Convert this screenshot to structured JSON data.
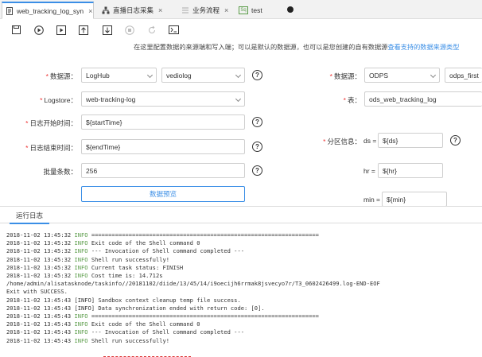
{
  "tabs": [
    {
      "label": "web_tracking_log_syn",
      "active": true,
      "close": "×",
      "icon": "document-icon"
    },
    {
      "label": "直播日志采集",
      "active": false,
      "close": "×",
      "icon": "flow-icon"
    },
    {
      "label": "业务流程",
      "active": false,
      "close": "×",
      "icon": "workflow-icon"
    },
    {
      "label": "test",
      "active": false,
      "close": "",
      "icon": "sql-icon",
      "icon_text": "Sq"
    }
  ],
  "toolbar": {
    "buttons": [
      "save-icon",
      "run-icon",
      "run-with-params-icon",
      "submit-icon",
      "download-icon",
      "stop-icon",
      "reload-icon",
      "format-icon"
    ]
  },
  "hint": {
    "text": "在这里配置数据的来源端和写入端；可以是默认的数据源，也可以是您创建的自有数据源",
    "link": "查看支持的数据来源类型"
  },
  "source": {
    "datasource_label": "数据源：",
    "datasource_type": "LogHub",
    "datasource_name": "vediolog",
    "logstore_label": "Logstore：",
    "logstore_value": "web-tracking-log",
    "start_label": "日志开始时间：",
    "start_value": "${startTime}",
    "end_label": "日志结束时间：",
    "end_value": "${endTime}",
    "batch_label": "批量条数：",
    "batch_value": "256",
    "preview_button": "数据预览",
    "help": "?"
  },
  "target": {
    "datasource_label": "数据源：",
    "datasource_type": "ODPS",
    "datasource_name": "odps_first",
    "table_label": "表：",
    "table_value": "ods_web_tracking_log",
    "partition_label": "分区信息：",
    "ds_label": "ds =",
    "ds_value": "${ds}",
    "hr_label": "hr =",
    "hr_value": "${hr}",
    "min_label": "min =",
    "min_value": "${min}",
    "help": "?"
  },
  "log": {
    "tab_label": "运行日志",
    "lines": [
      {
        "ts": "2018-11-02 13:45:32",
        "lvl": "INFO",
        "msg": "==================================================================="
      },
      {
        "ts": "2018-11-02 13:45:32",
        "lvl": "INFO",
        "msg": "Exit code of the Shell command 0"
      },
      {
        "ts": "2018-11-02 13:45:32",
        "lvl": "INFO",
        "msg": "--- Invocation of Shell command completed ---"
      },
      {
        "ts": "2018-11-02 13:45:32",
        "lvl": "INFO",
        "msg": "Shell run successfully!"
      },
      {
        "ts": "2018-11-02 13:45:32",
        "lvl": "INFO",
        "msg": "Current task status: FINISH"
      },
      {
        "ts": "2018-11-02 13:45:32",
        "lvl": "INFO",
        "msg": "Cost time is: 14.712s"
      },
      {
        "ts": "",
        "lvl": "",
        "msg": "/home/admin/alisatasknode/taskinfo//20181102/diide/13/45/14/i9oecijh6rrmak8jsvecyo7r/T3_0602426499.log-END-EOF"
      },
      {
        "ts": "",
        "lvl": "",
        "msg": "Exit with SUCCESS."
      },
      {
        "ts": "2018-11-02 13:45:43",
        "lvl": "[INFO]",
        "msg": "Sandbox context cleanup temp file success."
      },
      {
        "ts": "2018-11-02 13:45:43",
        "lvl": "[INFO]",
        "msg": "Data synchronization ended with return code: [0]."
      },
      {
        "ts": "2018-11-02 13:45:43",
        "lvl": "INFO",
        "msg": "==================================================================="
      },
      {
        "ts": "2018-11-02 13:45:43",
        "lvl": "INFO",
        "msg": "Exit code of the Shell command 0"
      },
      {
        "ts": "2018-11-02 13:45:43",
        "lvl": "INFO",
        "msg": "--- Invocation of Shell command completed ---"
      },
      {
        "ts": "2018-11-02 13:45:43",
        "lvl": "INFO",
        "msg": "Shell run successfully!"
      }
    ]
  },
  "colors": {
    "accent": "#3a8ee6",
    "required": "#ee3333",
    "info_level": "#5a9c48"
  }
}
